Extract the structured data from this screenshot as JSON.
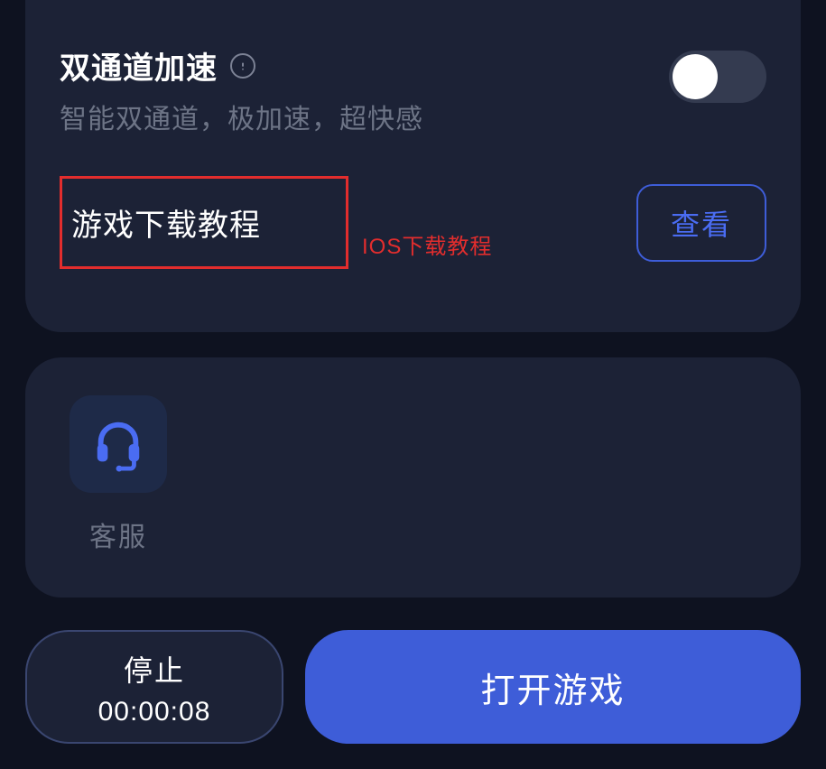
{
  "settings": {
    "dualChannel": {
      "title": "双通道加速",
      "subtitle": "智能双通道，极加速，超快感",
      "enabled": false
    },
    "tutorial": {
      "title": "游戏下载教程",
      "annotation": "IOS下载教程",
      "viewBtn": "查看"
    }
  },
  "actions": {
    "support": {
      "label": "客服"
    }
  },
  "footer": {
    "stopLabel": "停止",
    "timer": "00:00:08",
    "openGameLabel": "打开游戏"
  },
  "colors": {
    "background": "#0e1220",
    "card": "#1c2236",
    "accent": "#3e5dd8",
    "annotation": "#e22d2d",
    "muted": "#6d7486"
  }
}
